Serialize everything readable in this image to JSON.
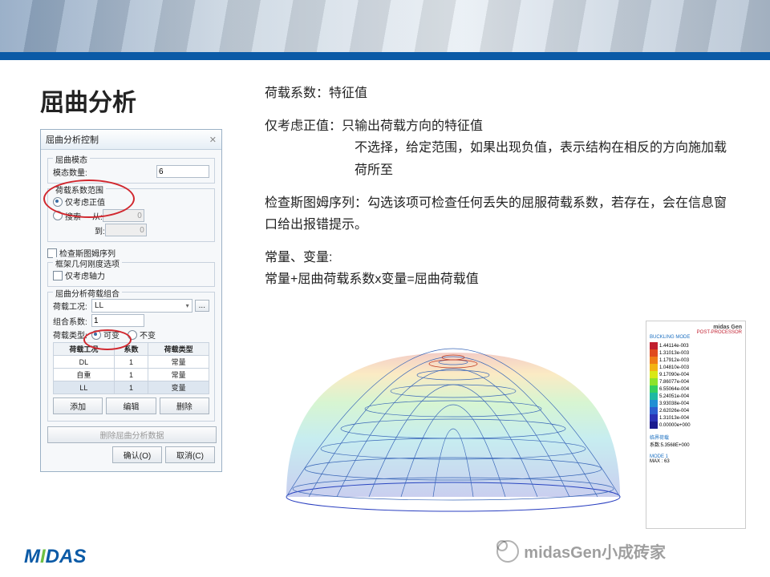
{
  "page": {
    "title": "屈曲分析"
  },
  "text": {
    "p1": "荷载系数：特征值",
    "p2a": "仅考虑正值：只输出荷载方向的特征值",
    "p2b": "不选择，给定范围，如果出现负值，表示结构在相反的方向施加载荷所至",
    "p3": "检查斯图姆序列：勾选该项可检查任何丢失的屈服荷载系数，若存在，会在信息窗口给出报错提示。",
    "p4a": "常量、变量:",
    "p4b": "常量+屈曲荷载系数x变量=屈曲荷载值"
  },
  "dialog": {
    "title": "屈曲分析控制",
    "close": "✕",
    "g_mode": "屈曲模态",
    "mode_count_label": "模态数量:",
    "mode_count": "6",
    "g_coef": "荷载系数范围",
    "r_positive": "仅考虑正值",
    "r_range": "搜索",
    "from_label": "从:",
    "from": "0",
    "to_label": "到:",
    "to": "0",
    "chk_sturm": "检查斯图姆序列",
    "g_frame": "框架几何刚度选项",
    "chk_axial": "仅考虑轴力",
    "g_comb": "屈曲分析荷载组合",
    "lc_label": "荷载工况:",
    "lc_value": "LL",
    "more": "...",
    "factor_label": "组合系数:",
    "factor": "1",
    "type_label": "荷载类型:",
    "r_var": "可变",
    "r_const": "不变",
    "th1": "荷载工况",
    "th2": "系数",
    "th3": "荷载类型",
    "rows": [
      {
        "c1": "DL",
        "c2": "1",
        "c3": "常量"
      },
      {
        "c1": "自重",
        "c2": "1",
        "c3": "常量"
      },
      {
        "c1": "LL",
        "c2": "1",
        "c3": "变量"
      }
    ],
    "add": "添加",
    "edit": "编辑",
    "del": "删除",
    "remove_data": "删除屈曲分析数据",
    "ok": "确认(O)",
    "cancel": "取消(C)"
  },
  "legend": {
    "title": "midas Gen",
    "sub1": "POST-PROCESSOR",
    "sub2": "BUCKLING MODE",
    "items": [
      {
        "c": "#c11f2f",
        "v": "1.44114e-003"
      },
      {
        "c": "#e04a1e",
        "v": "1.31013e-003"
      },
      {
        "c": "#ef7c16",
        "v": "1.17912e-003"
      },
      {
        "c": "#f3b312",
        "v": "1.04810e-003"
      },
      {
        "c": "#d9e815",
        "v": "9.17090e-004"
      },
      {
        "c": "#8de32a",
        "v": "7.86077e-004"
      },
      {
        "c": "#34d05f",
        "v": "6.55064e-004"
      },
      {
        "c": "#1eb9a3",
        "v": "5.24051e-004"
      },
      {
        "c": "#1f8fd4",
        "v": "3.93038e-004"
      },
      {
        "c": "#2b5ed0",
        "v": "2.62026e-004"
      },
      {
        "c": "#2a32b5",
        "v": "1.31013e-004"
      },
      {
        "c": "#1b1b8f",
        "v": "0.00000e+000"
      }
    ],
    "info1": "临界荷载",
    "info2": "系数:5.3568E+000",
    "mode": "MODE 1",
    "max": "MAX : 63"
  },
  "footer": {
    "logo": "MIDAS",
    "watermark": "midasGen小成砖家"
  }
}
